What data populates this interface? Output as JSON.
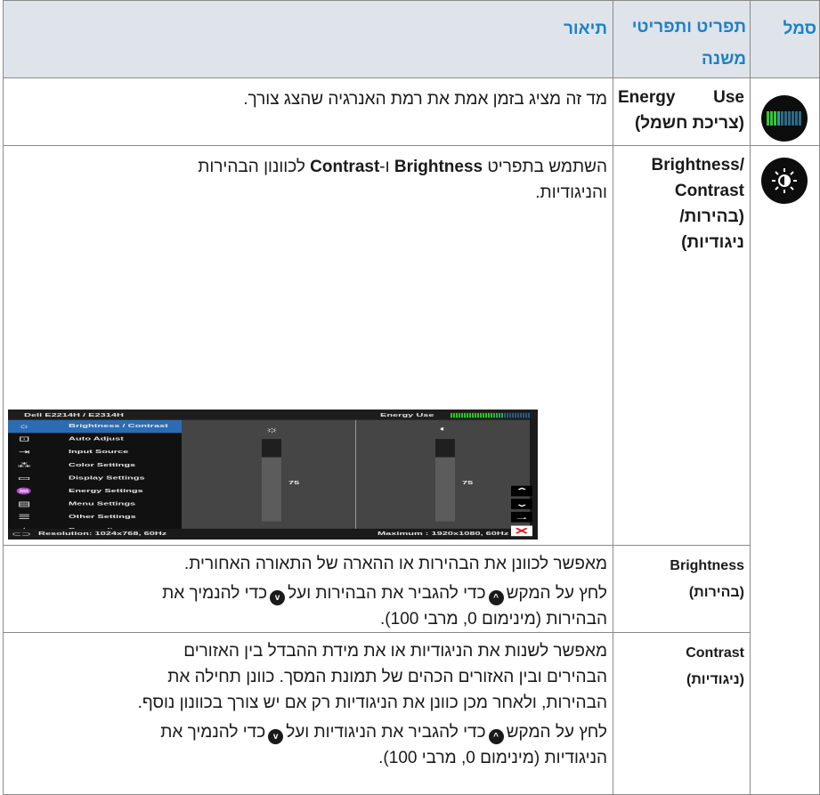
{
  "header": {
    "icon_col": "סמל",
    "feature_col": "תפריט ותפריטי משנה",
    "description_col": "תיאור"
  },
  "rows": {
    "energy": {
      "feature_en": "Energy Use",
      "feature_he": "(צריכת חשמל)",
      "icon": "energy-meter-icon",
      "description": "מד זה מציג בזמן אמת את רמת האנרגיה שהצג צורך."
    },
    "brightness_contrast": {
      "feature_en1": "Brightness/",
      "feature_en2": "Contrast",
      "feature_he1": "(בהירות/",
      "feature_he2": "ניגודיות)",
      "icon": "sun-brightness-icon",
      "description_pre": "השתמש בתפריט",
      "description_b1": "Brightness",
      "description_mid": "ו-",
      "description_b2": "Contrast",
      "description_post": "לכוונון הבהירות",
      "description_line2": "והניגודיות."
    },
    "brightness": {
      "feature_en": "Brightness",
      "feature_he": "(בהירות)",
      "line1": "מאפשר לכוונן את הבהירות או ההארה של התאורה האחורית.",
      "line2_a": "לחץ על המקש",
      "line2_b": "כדי להגביר את הבהירות ועל",
      "line2_c": "כדי להנמיך את",
      "line3": "הבהירות (מינימום 0, מרבי 100)."
    },
    "contrast": {
      "feature_en": "Contrast",
      "feature_he": "(ניגודיות)",
      "line1": "מאפשר לשנות את הניגודיות או את מידת ההבדל בין האזורים",
      "line2": "הבהירים ובין האזורים הכהים של תמונת המסך. כוונן תחילה את",
      "line3": "הבהירות, ולאחר מכן כוונן את הניגודיות רק אם יש צורך בכוונון נוסף.",
      "line4_a": "לחץ על המקש",
      "line4_b": "כדי להגביר את הניגודיות ועל",
      "line4_c": "כדי להנמיך את",
      "line5": "הניגודיות (מינימום 0, מרבי 100)."
    }
  },
  "osd": {
    "title": "Dell E2214H / E2314H",
    "energy_label": "Energy Use",
    "energy_level": 0.65,
    "menu": [
      {
        "label": "Brightness / Contrast",
        "icon": "sun-icon",
        "active": true
      },
      {
        "label": "Auto Adjust",
        "icon": "auto-adjust-icon",
        "active": false
      },
      {
        "label": "Input Source",
        "icon": "input-source-icon",
        "active": false
      },
      {
        "label": "Color Settings",
        "icon": "color-settings-icon",
        "active": false
      },
      {
        "label": "Display Settings",
        "icon": "display-settings-icon",
        "active": false
      },
      {
        "label": "Energy Settings",
        "icon": "energy-settings-icon",
        "active": false
      },
      {
        "label": "Menu Settings",
        "icon": "menu-settings-icon",
        "active": false
      },
      {
        "label": "Other Settings",
        "icon": "other-settings-icon",
        "active": false
      },
      {
        "label": "Personalize",
        "icon": "star-icon",
        "active": false
      }
    ],
    "brightness_value": "75",
    "contrast_value": "75",
    "resolution": "Resolution: 1024x768,  60Hz",
    "maximum": "Maximum : 1920x1080,  60Hz"
  },
  "colors": {
    "header_text": "#1b82c5",
    "header_bg": "#dfe3ea",
    "osd_active": "#2b6cb4",
    "nav_close": "#e01818"
  }
}
